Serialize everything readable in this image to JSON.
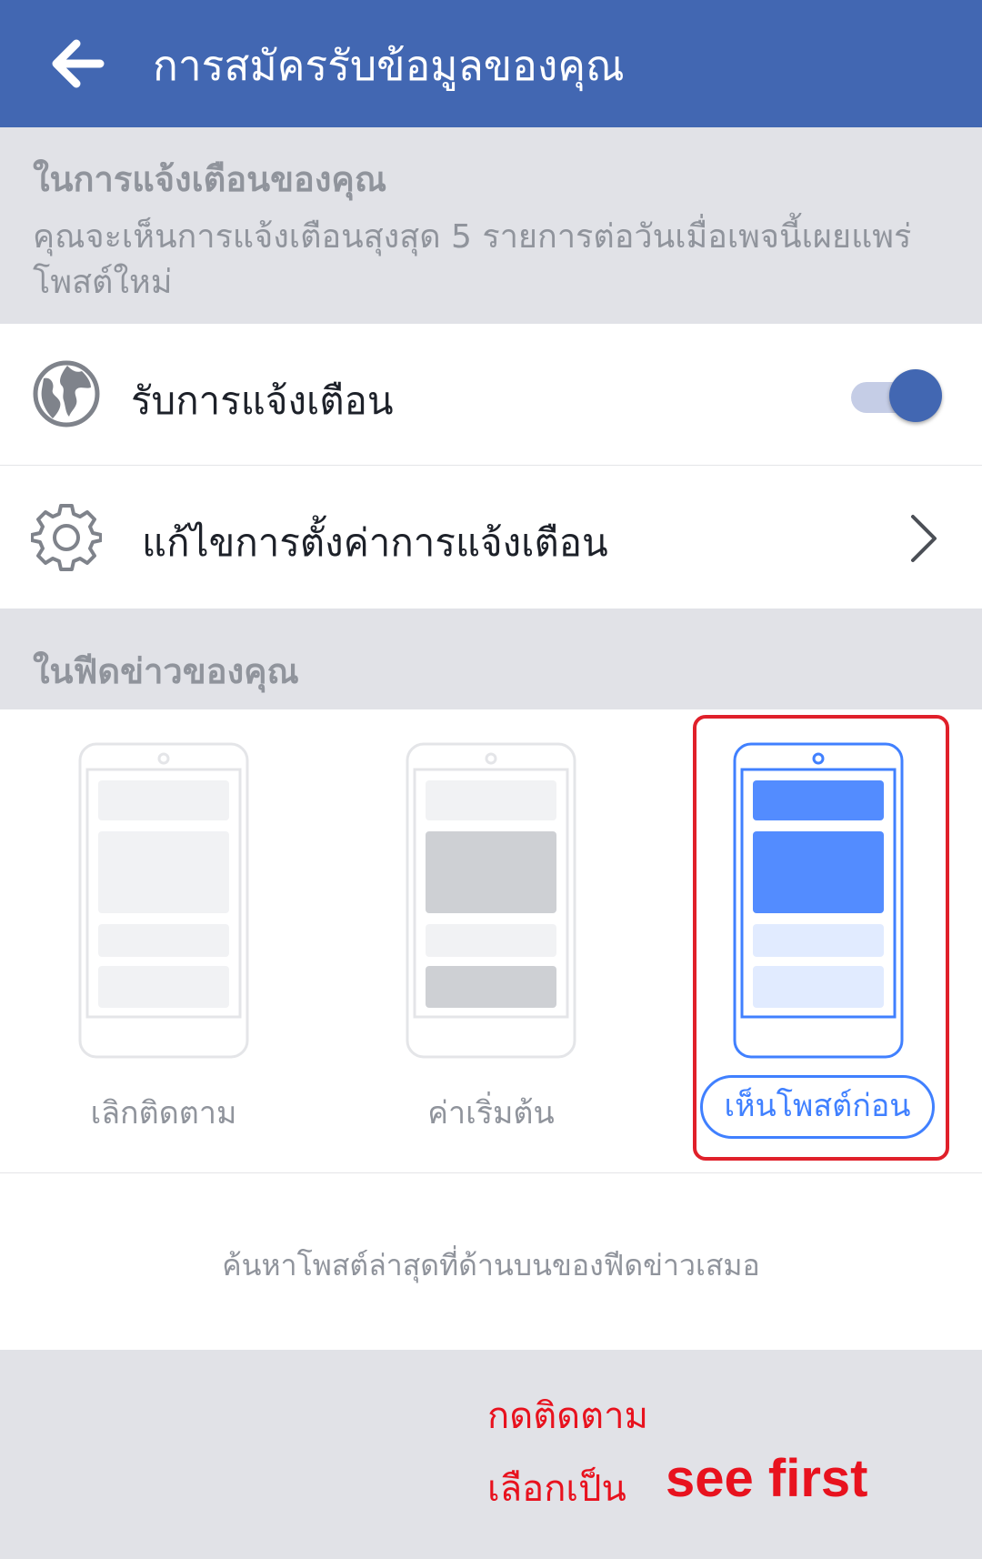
{
  "header": {
    "title": "การสมัครรับข้อมูลของคุณ",
    "back_icon": "arrow-left-icon",
    "background": "#4267b2"
  },
  "notifications_section": {
    "title": "ในการแจ้งเตือนของคุณ",
    "description": "คุณจะเห็นการแจ้งเตือนสุงสุด 5 รายการต่อวันเมื่อเพจนี้เผยแพร่โพสต์ใหม่"
  },
  "notify_row": {
    "label": "รับการแจ้งเตือน",
    "icon": "globe-icon",
    "toggle_on": true
  },
  "edit_row": {
    "label": "แก้ไขการตั้งค่าการแจ้งเตือน",
    "icon": "gear-icon",
    "chevron_icon": "chevron-right-icon"
  },
  "feed_section": {
    "title": "ในฟีดข่าวของคุณ",
    "options": [
      {
        "label": "เลิกติดตาม",
        "icon": "phone-feed-icon",
        "selected": false
      },
      {
        "label": "ค่าเริ่มต้น",
        "icon": "phone-feed-icon",
        "selected": false
      },
      {
        "label": "เห็นโพสต์ก่อน",
        "icon": "phone-feed-icon",
        "selected": true
      }
    ],
    "hint": "ค้นหาโพสต์ล่าสุดที่ด้านบนของฟีดข่าวเสมอ"
  },
  "annotation": {
    "line1": "กดติดตาม",
    "line2_thai": "เลือกเป็น",
    "line2_english": "see first",
    "color": "#e8121e"
  },
  "colors": {
    "brand": "#4267b2",
    "accent": "#4080ff",
    "secondary_text": "#90949c",
    "section_bg": "#e1e2e7"
  }
}
